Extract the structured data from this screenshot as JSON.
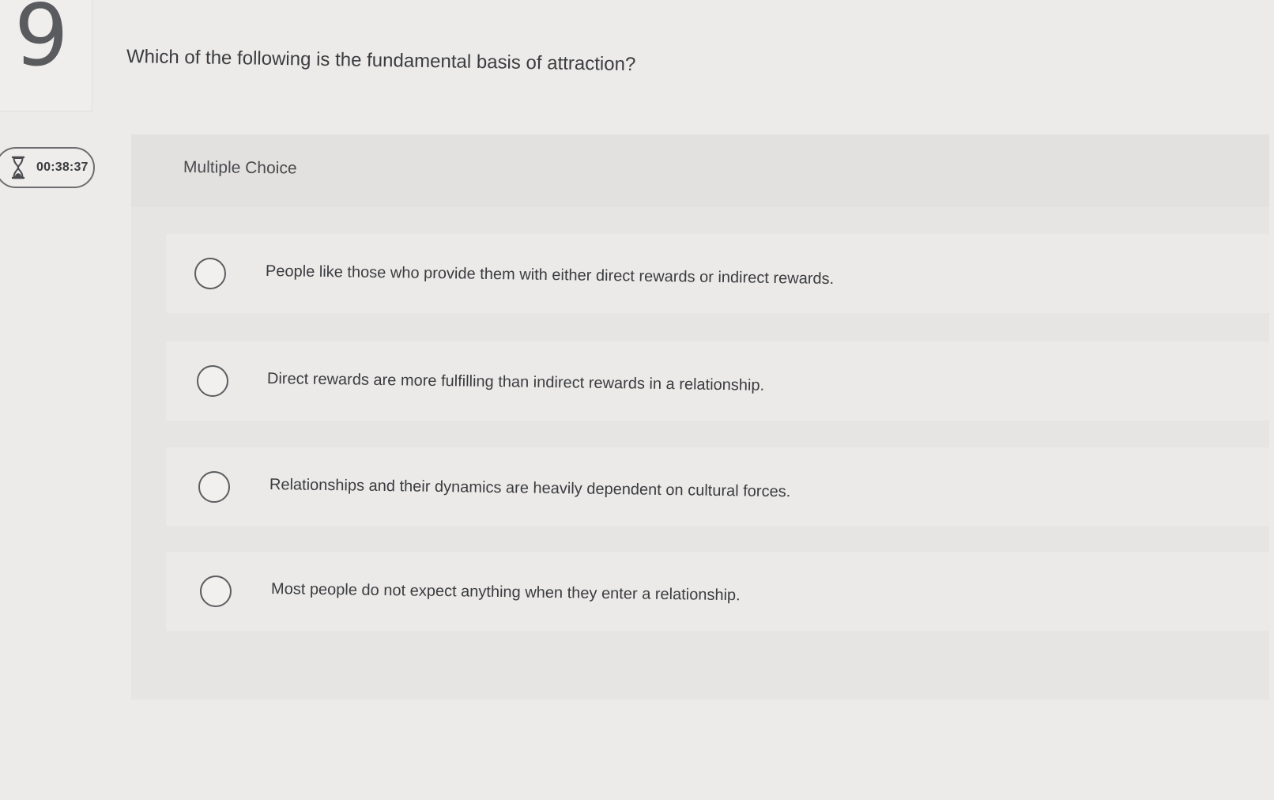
{
  "question": {
    "number": "9",
    "text": "Which of the following is the fundamental basis of attraction?"
  },
  "timer": {
    "icon": "hourglass-icon",
    "time": "00:38:37"
  },
  "panel": {
    "type_label": "Multiple Choice",
    "options": [
      {
        "label": "People like those who provide them with either direct rewards or indirect rewards."
      },
      {
        "label": "Direct rewards are more fulfilling than indirect rewards in a relationship."
      },
      {
        "label": "Relationships and their dynamics are heavily dependent on cultural forces."
      },
      {
        "label": "Most people do not expect anything when they enter a relationship."
      }
    ]
  },
  "colors": {
    "background": "#ecebe9",
    "panel": "#e6e5e3",
    "text": "#3b3c40",
    "radio_border": "#5c5d61"
  }
}
